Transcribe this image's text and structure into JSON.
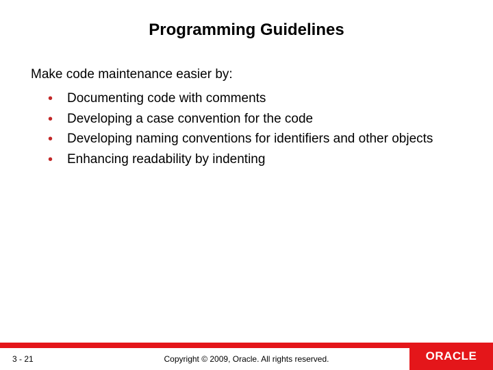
{
  "title": "Programming Guidelines",
  "intro": "Make code maintenance easier by:",
  "bullets": [
    "Documenting code with comments",
    "Developing a case convention for the code",
    "Developing naming conventions for identifiers and other objects",
    "Enhancing readability by indenting"
  ],
  "footer": {
    "page": "3 - 21",
    "copyright": "Copyright © 2009, Oracle. All rights reserved.",
    "logo": "ORACLE"
  },
  "colors": {
    "accent": "#e4161a",
    "bullet": "#c22727"
  }
}
